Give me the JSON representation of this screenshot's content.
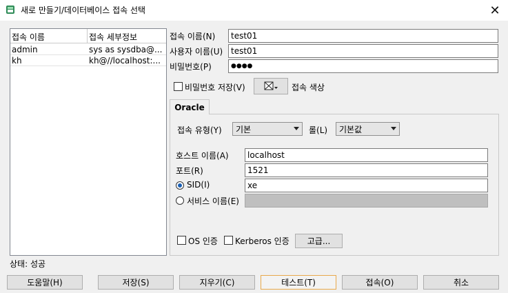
{
  "window": {
    "title": "새로 만들기/데이터베이스 접속 선택",
    "close_glyph": "✕"
  },
  "connections": {
    "headers": [
      "접속 이름",
      "접속 세부정보"
    ],
    "rows": [
      {
        "name": "admin",
        "detail": "sys as sysdba@..."
      },
      {
        "name": "kh",
        "detail": "kh@//localhost:..."
      }
    ]
  },
  "form": {
    "connection_name_label": "접속 이름(N)",
    "connection_name_value": "test01",
    "username_label": "사용자 이름(U)",
    "username_value": "test01",
    "password_label": "비밀번호(P)",
    "password_value": "●●●●",
    "save_password_label": "비밀번호 저장(V)",
    "connection_color_label": "접속 색상"
  },
  "oracle_tab": {
    "tab_label": "Oracle",
    "connection_type_label": "접속 유형(Y)",
    "connection_type_value": "기본",
    "role_label": "롤(L)",
    "role_value": "기본값",
    "host_label": "호스트 이름(A)",
    "host_value": "localhost",
    "port_label": "포트(R)",
    "port_value": "1521",
    "sid_label": "SID(I)",
    "sid_value": "xe",
    "service_name_label": "서비스 이름(E)",
    "service_name_value": "",
    "os_auth_label": "OS 인증",
    "kerberos_label": "Kerberos 인증",
    "advanced_label": "고급..."
  },
  "status": {
    "text": "상태: 성공"
  },
  "buttons": {
    "help": "도움말(H)",
    "save": "저장(S)",
    "clear": "지우기(C)",
    "test": "테스트(T)",
    "connect": "접속(O)",
    "cancel": "취소"
  },
  "icons": {
    "app": "sql-developer-db-icon",
    "color_picker": "color-swatch-icon",
    "close": "close-icon"
  }
}
